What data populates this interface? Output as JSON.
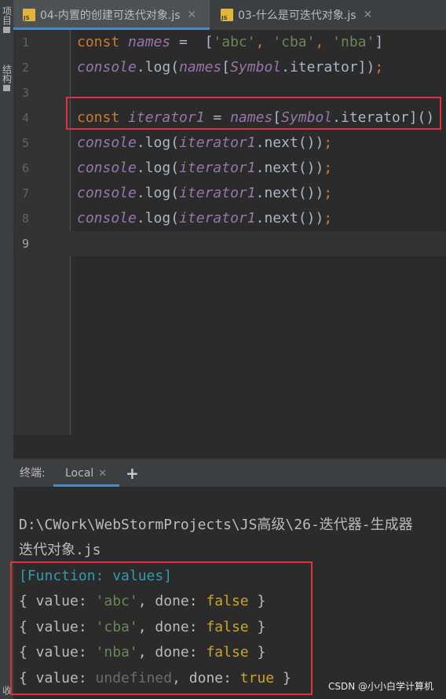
{
  "left_strip": {
    "project_label": "项目",
    "structure_label": "结构",
    "bottom_label": "收"
  },
  "tabs": [
    {
      "label": "04-内置的创建可迭代对象.js",
      "active": true
    },
    {
      "label": "03-什么是可迭代对象.js",
      "active": false
    }
  ],
  "editor": {
    "line_numbers": [
      "1",
      "2",
      "3",
      "4",
      "5",
      "6",
      "7",
      "8",
      "9"
    ],
    "current_line": 9,
    "lines": [
      [
        {
          "t": "const ",
          "c": "kw"
        },
        {
          "t": "names",
          "c": "var"
        },
        {
          "t": " =  [",
          "c": "pn"
        },
        {
          "t": "'abc'",
          "c": "str"
        },
        {
          "t": ", ",
          "c": "kw"
        },
        {
          "t": "'cba'",
          "c": "str"
        },
        {
          "t": ", ",
          "c": "kw"
        },
        {
          "t": "'nba'",
          "c": "str"
        },
        {
          "t": "]",
          "c": "pn"
        }
      ],
      [
        {
          "t": "console",
          "c": "glob"
        },
        {
          "t": ".",
          "c": "pn"
        },
        {
          "t": "log",
          "c": "plain"
        },
        {
          "t": "(",
          "c": "pn"
        },
        {
          "t": "names",
          "c": "var"
        },
        {
          "t": "[",
          "c": "pn"
        },
        {
          "t": "Symbol",
          "c": "glob"
        },
        {
          "t": ".",
          "c": "pn"
        },
        {
          "t": "iterator",
          "c": "plain"
        },
        {
          "t": "])",
          "c": "pn"
        },
        {
          "t": ";",
          "c": "kw"
        }
      ],
      [],
      [
        {
          "t": "const ",
          "c": "kw"
        },
        {
          "t": "iterator1",
          "c": "var"
        },
        {
          "t": " = ",
          "c": "pn"
        },
        {
          "t": "names",
          "c": "var"
        },
        {
          "t": "[",
          "c": "pn"
        },
        {
          "t": "Symbol",
          "c": "glob"
        },
        {
          "t": ".",
          "c": "pn"
        },
        {
          "t": "iterator",
          "c": "plain"
        },
        {
          "t": "]()",
          "c": "pn"
        }
      ],
      [
        {
          "t": "console",
          "c": "glob"
        },
        {
          "t": ".",
          "c": "pn"
        },
        {
          "t": "log",
          "c": "plain"
        },
        {
          "t": "(",
          "c": "pn"
        },
        {
          "t": "iterator1",
          "c": "var"
        },
        {
          "t": ".",
          "c": "pn"
        },
        {
          "t": "next",
          "c": "plain"
        },
        {
          "t": "())",
          "c": "pn"
        },
        {
          "t": ";",
          "c": "kw"
        }
      ],
      [
        {
          "t": "console",
          "c": "glob"
        },
        {
          "t": ".",
          "c": "pn"
        },
        {
          "t": "log",
          "c": "plain"
        },
        {
          "t": "(",
          "c": "pn"
        },
        {
          "t": "iterator1",
          "c": "var"
        },
        {
          "t": ".",
          "c": "pn"
        },
        {
          "t": "next",
          "c": "plain"
        },
        {
          "t": "())",
          "c": "pn"
        },
        {
          "t": ";",
          "c": "kw"
        }
      ],
      [
        {
          "t": "console",
          "c": "glob"
        },
        {
          "t": ".",
          "c": "pn"
        },
        {
          "t": "log",
          "c": "plain"
        },
        {
          "t": "(",
          "c": "pn"
        },
        {
          "t": "iterator1",
          "c": "var"
        },
        {
          "t": ".",
          "c": "pn"
        },
        {
          "t": "next",
          "c": "plain"
        },
        {
          "t": "())",
          "c": "pn"
        },
        {
          "t": ";",
          "c": "kw"
        }
      ],
      [
        {
          "t": "console",
          "c": "glob"
        },
        {
          "t": ".",
          "c": "pn"
        },
        {
          "t": "log",
          "c": "plain"
        },
        {
          "t": "(",
          "c": "pn"
        },
        {
          "t": "iterator1",
          "c": "var"
        },
        {
          "t": ".",
          "c": "pn"
        },
        {
          "t": "next",
          "c": "plain"
        },
        {
          "t": "())",
          "c": "pn"
        },
        {
          "t": ";",
          "c": "kw"
        }
      ],
      []
    ]
  },
  "terminal": {
    "title": "终端:",
    "tab_label": "Local",
    "add_symbol": "+",
    "lines": [
      [],
      [
        {
          "t": "D:\\CWork\\WebStormProjects\\JS高级\\26-迭代器-生成器",
          "c": "plain"
        }
      ],
      [
        {
          "t": "迭代对象.js",
          "c": "plain"
        }
      ],
      [
        {
          "t": "[Function: values]",
          "c": "cyan"
        }
      ],
      [
        {
          "t": "{ value: ",
          "c": "plain"
        },
        {
          "t": "'abc'",
          "c": "green"
        },
        {
          "t": ", done: ",
          "c": "plain"
        },
        {
          "t": "false",
          "c": "yellow"
        },
        {
          "t": " }",
          "c": "plain"
        }
      ],
      [
        {
          "t": "{ value: ",
          "c": "plain"
        },
        {
          "t": "'cba'",
          "c": "green"
        },
        {
          "t": ", done: ",
          "c": "plain"
        },
        {
          "t": "false",
          "c": "yellow"
        },
        {
          "t": " }",
          "c": "plain"
        }
      ],
      [
        {
          "t": "{ value: ",
          "c": "plain"
        },
        {
          "t": "'nba'",
          "c": "green"
        },
        {
          "t": ", done: ",
          "c": "plain"
        },
        {
          "t": "false",
          "c": "yellow"
        },
        {
          "t": " }",
          "c": "plain"
        }
      ],
      [
        {
          "t": "{ value: ",
          "c": "plain"
        },
        {
          "t": "undefined",
          "c": "gray"
        },
        {
          "t": ", done: ",
          "c": "plain"
        },
        {
          "t": "true",
          "c": "yellow"
        },
        {
          "t": " }",
          "c": "plain"
        }
      ]
    ]
  },
  "watermark": "CSDN @小小白学计算机"
}
